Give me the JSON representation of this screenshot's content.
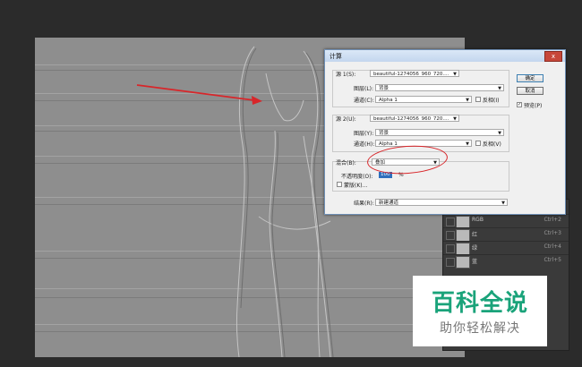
{
  "dialog": {
    "title": "计算",
    "close_label": "x",
    "source1": {
      "label": "源 1(S):",
      "file": "beautiful-1274056_960_720....",
      "layer_label": "图层(L):",
      "layer": "背景",
      "channel_label": "通道(C):",
      "channel": "Alpha 1",
      "invert_label": "反相(I)"
    },
    "source2": {
      "label": "源 2(U):",
      "file": "beautiful-1274056_960_720....",
      "layer_label": "图层(Y):",
      "layer": "背景",
      "channel_label": "通道(H):",
      "channel": "Alpha 1",
      "invert_label": "反相(V)"
    },
    "blending": {
      "label": "混合(B):",
      "value": "叠加",
      "opacity_label": "不透明度(O):",
      "opacity_value": "100",
      "opacity_unit": "%",
      "mask_label": "蒙版(K)..."
    },
    "result": {
      "label": "结果(R):",
      "value": "新建通道"
    },
    "ok_label": "确定",
    "cancel_label": "取消",
    "preview_label": "预览(P)",
    "preview_checked": true
  },
  "channels": [
    {
      "name": "RGB",
      "shortcut": "Ctrl+2"
    },
    {
      "name": "红",
      "shortcut": "Ctrl+3"
    },
    {
      "name": "绿",
      "shortcut": "Ctrl+4"
    },
    {
      "name": "蓝",
      "shortcut": "Ctrl+5"
    }
  ],
  "watermark": {
    "title": "百科全说",
    "subtitle": "助你轻松解决",
    "color": "#1aa37a"
  },
  "annotations": {
    "arrow_color": "#d8262a",
    "highlight_color": "#d8262a"
  },
  "colors": {
    "workspace": "#2b2b2b",
    "canvas": "#8e8e8e",
    "dialog_bg": "#f0f0f0",
    "titlebar": "#c3d6ee"
  }
}
